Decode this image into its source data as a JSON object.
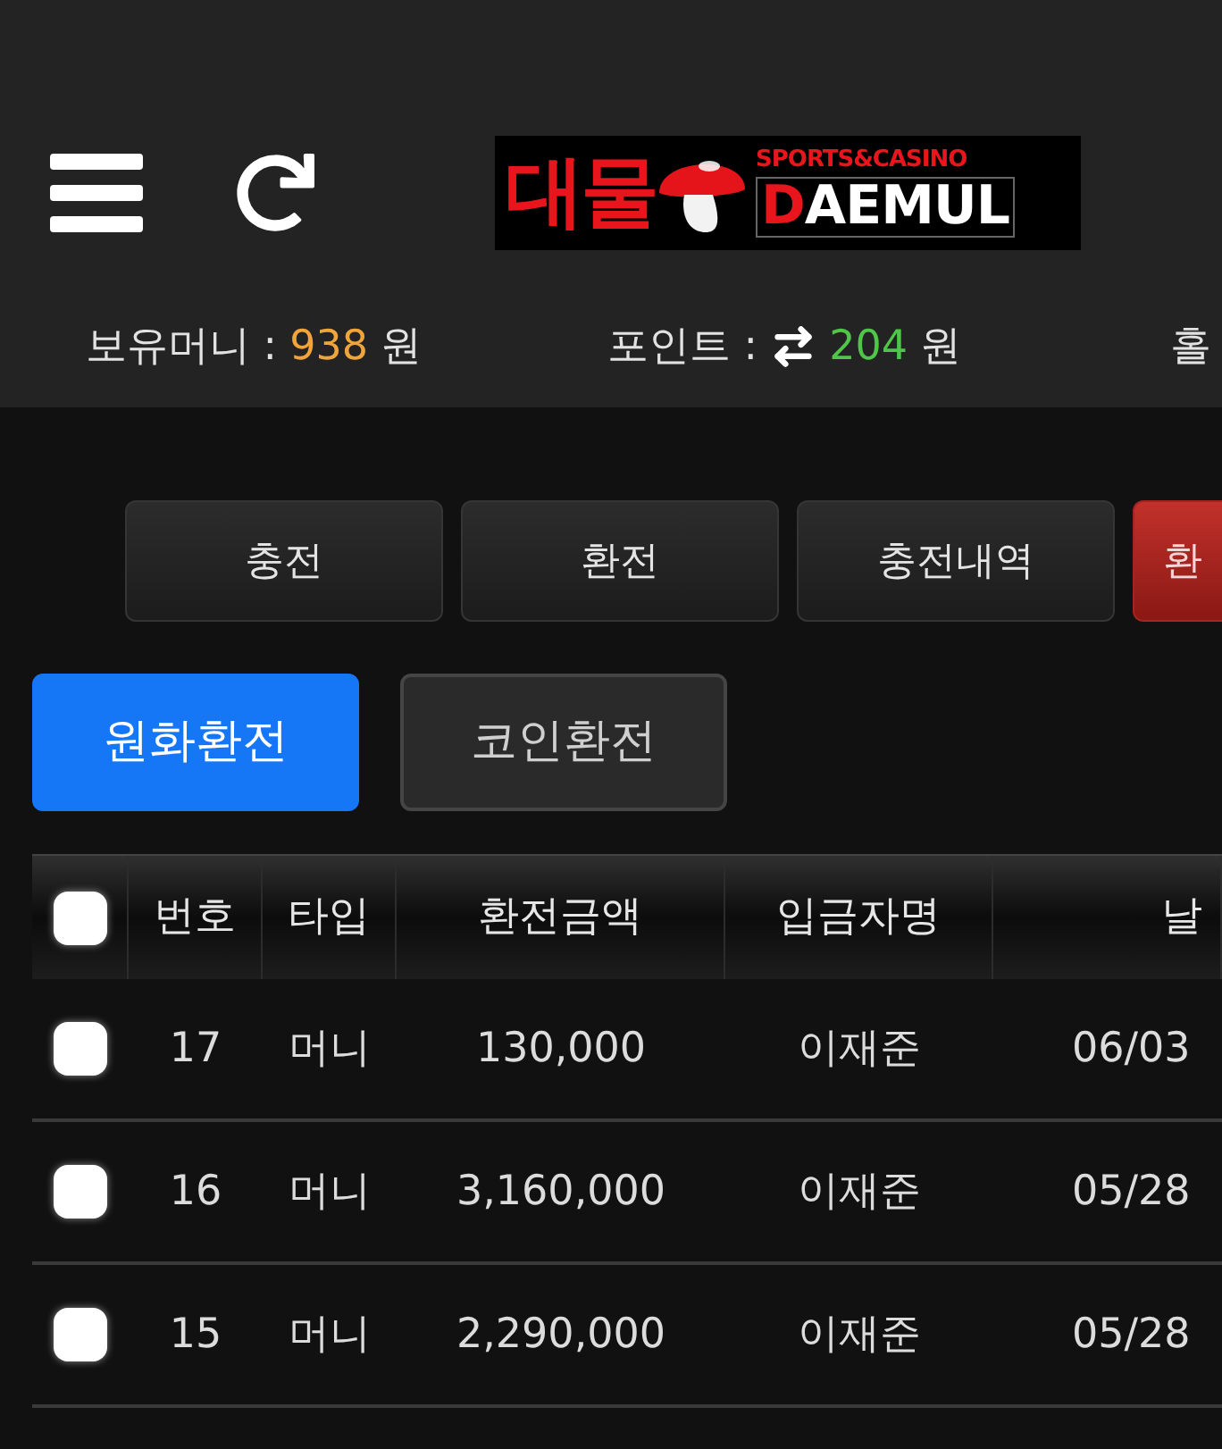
{
  "header": {
    "logo": {
      "wordmark": "대물",
      "tagline": "SPORTS&CASINO",
      "name": "DAEMUL"
    }
  },
  "balances": [
    {
      "label": "보유머니 :",
      "exchange_icon": false,
      "value": "938",
      "unit": "원",
      "color": "#f0a43a"
    },
    {
      "label": "포인트 :",
      "exchange_icon": true,
      "value": "204",
      "unit": "원",
      "color": "#4fc54a"
    },
    {
      "label": "홀"
    }
  ],
  "nav_buttons": [
    {
      "label": "충전",
      "selected": false
    },
    {
      "label": "환전",
      "selected": false
    },
    {
      "label": "충전내역",
      "selected": false
    },
    {
      "label": "환",
      "selected": true
    }
  ],
  "exchange_tabs": [
    {
      "label": "원화환전",
      "selected": true
    },
    {
      "label": "코인환전",
      "selected": false
    }
  ],
  "table": {
    "select_all": {
      "checked": false
    },
    "columns": [
      "번호",
      "타입",
      "환전금액",
      "입금자명",
      "날"
    ],
    "rows": [
      {
        "checked": false,
        "cells": [
          "17",
          "머니",
          "130,000",
          "이재준",
          "06/03"
        ]
      },
      {
        "checked": false,
        "cells": [
          "16",
          "머니",
          "3,160,000",
          "이재준",
          "05/28"
        ]
      },
      {
        "checked": false,
        "cells": [
          "15",
          "머니",
          "2,290,000",
          "이재준",
          "05/28"
        ]
      }
    ]
  }
}
